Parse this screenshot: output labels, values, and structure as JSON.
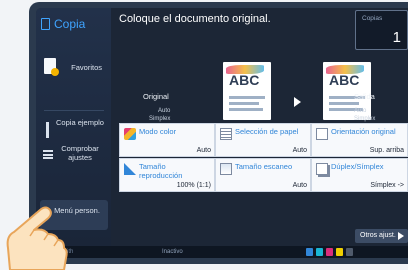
{
  "app": {
    "mode_title": "Copia"
  },
  "sidebar": {
    "favoritos": "Favoritos",
    "copia_ejemplo": "Copia ejemplo",
    "comprobar": "Comprobar ajustes",
    "menu_person": "Menú person."
  },
  "instruction": "Coloque el documento original.",
  "copies": {
    "label": "Copias",
    "value": "1"
  },
  "original": {
    "label": "Original",
    "mode": "Auto",
    "sides": "Simplex",
    "thumb_text": "ABC"
  },
  "salida": {
    "label": "Salida",
    "mode": "Auto",
    "sides": "Simplex",
    "thumb_text": "ABC"
  },
  "functions": [
    {
      "title": "Modo color",
      "value": "Auto",
      "icon": "color-mode-icon"
    },
    {
      "title": "Selección de papel",
      "value": "Auto",
      "icon": "paper-select-icon"
    },
    {
      "title": "Orientación original",
      "value": "Sup. arriba",
      "icon": "orientation-icon"
    },
    {
      "title": "Tamaño reproducción",
      "value": "100% (1:1)",
      "icon": "zoom-icon"
    },
    {
      "title": "Tamaño escaneo",
      "value": "Auto",
      "icon": "scan-size-icon"
    },
    {
      "title": "Dúplex/Símplex",
      "value": "Símplex ->",
      "icon": "duplex-icon"
    }
  ],
  "otros": "Otros ajust.",
  "status": {
    "user": "Smith",
    "state": "Inactivo"
  },
  "colors": {
    "accent": "#3fa4ff",
    "bg": "#1c2636",
    "tile": "#f7f9fc"
  }
}
